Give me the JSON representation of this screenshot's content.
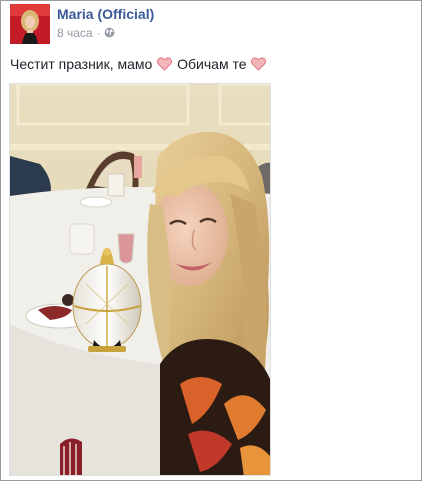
{
  "post": {
    "author": "Maria (Official)",
    "timestamp": "8 часа",
    "separator": "·",
    "privacy_icon": "globe-icon",
    "text_part1": "Честит празник, мамо",
    "text_part2": "Обичам те",
    "emoji": "heart-icon",
    "heart_color": "#e77b83"
  },
  "colors": {
    "author_link": "#3b5998",
    "meta_text": "#9197a3",
    "body_text": "#1d2129"
  }
}
